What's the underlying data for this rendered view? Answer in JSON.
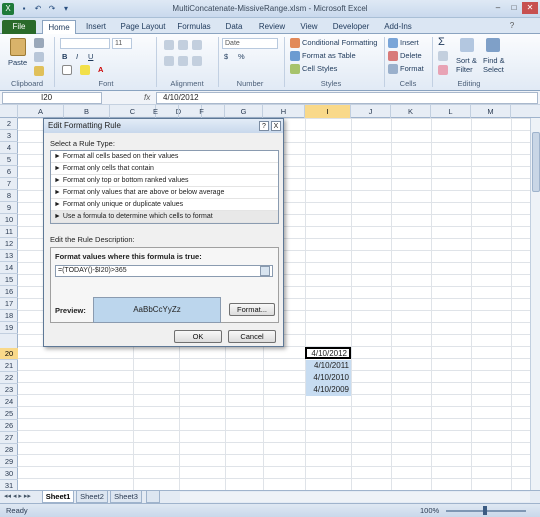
{
  "window": {
    "title": "MultiConcatenate-MissiveRange.xlsm - Microsoft Excel"
  },
  "ribbon": {
    "tabs": [
      "File",
      "Home",
      "Insert",
      "Page Layout",
      "Formulas",
      "Data",
      "Review",
      "View",
      "Developer",
      "Add-Ins"
    ],
    "clipboard": {
      "paste": "Paste",
      "label": "Clipboard"
    },
    "font": {
      "label": "Font",
      "size": "11"
    },
    "alignment": {
      "label": "Alignment"
    },
    "number": {
      "label": "Number",
      "format": "Date",
      "dollar": "$",
      "percent": "%"
    },
    "styles": {
      "label": "Styles",
      "conditional": "Conditional Formatting",
      "format_table": "Format as Table",
      "cell_styles": "Cell Styles"
    },
    "cells": {
      "label": "Cells",
      "insert": "Insert",
      "delete": "Delete",
      "format": "Format"
    },
    "editing": {
      "label": "Editing",
      "sort": "Sort &",
      "filter": "Filter",
      "find": "Find &",
      "select": "Select"
    }
  },
  "formula_bar": {
    "name_box": "I20",
    "fx": "fx",
    "value": "4/10/2012"
  },
  "grid": {
    "columns": [
      "A",
      "B",
      "C",
      "D",
      "E",
      "F",
      "G",
      "H",
      "I",
      "J",
      "K",
      "L",
      "M"
    ],
    "rows": [
      "2",
      "3",
      "4",
      "5",
      "6",
      "7",
      "8",
      "9",
      "10",
      "11",
      "12",
      "13",
      "14",
      "15",
      "16",
      "17",
      "18",
      "19",
      "20",
      "21",
      "22",
      "23",
      "24",
      "25",
      "26",
      "27",
      "28",
      "29",
      "30",
      "31"
    ],
    "values": [
      {
        "row": "20",
        "col": "I",
        "text": "4/10/2012"
      },
      {
        "row": "21",
        "col": "I",
        "text": "4/10/2011"
      },
      {
        "row": "22",
        "col": "I",
        "text": "4/10/2010"
      },
      {
        "row": "23",
        "col": "I",
        "text": "4/10/2009"
      }
    ]
  },
  "dialog": {
    "title": "Edit Formatting Rule",
    "help": "?",
    "close": "X",
    "select_type_label": "Select a Rule Type:",
    "rule_types": [
      "► Format all cells based on their values",
      "► Format only cells that contain",
      "► Format only top or bottom ranked values",
      "► Format only values that are above or below average",
      "► Format only unique or duplicate values",
      "► Use a formula to determine which cells to format"
    ],
    "edit_desc_label": "Edit the Rule Description:",
    "formula_label": "Format values where this formula is true:",
    "formula": "=(TODAY()-$I20)>365",
    "preview_label": "Preview:",
    "preview_text": "AaBbCcYyZz",
    "format_button": "Format...",
    "ok_button": "OK",
    "cancel_button": "Cancel"
  },
  "sheets": [
    "Sheet1",
    "Sheet2",
    "Sheet3"
  ],
  "status": {
    "mode": "Ready",
    "zoom": "100%"
  }
}
